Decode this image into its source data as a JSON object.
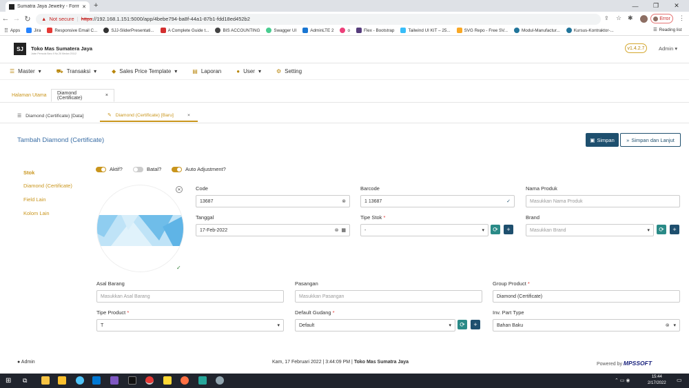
{
  "browser": {
    "tab_title": "Sumatra Jaya Jewelry - Form Di...",
    "not_secure": "Not secure",
    "url_scheme": "https",
    "url_rest": "://192.168.1.151:5000/app/4bebe794-ba8f-44a1-87b1-fdd18ed452b2",
    "error_label": "Error",
    "bookmarks": [
      "Apps",
      "Jira",
      "Responsive Email C...",
      "SJJ-SliderPresentati...",
      "A Complete Guide t...",
      "BIS ACCOUNTING",
      "Swagger UI",
      "AdminLTE 2",
      "o",
      "Flex - Bootstrap",
      "Tailwind UI KIT – 25...",
      "SVG Repo - Free SV...",
      "Modul-Manufactur...",
      "Kursus-Kontraktor-..."
    ],
    "reading_list": "Reading list"
  },
  "app": {
    "brand": "Toko Mas Sumatera Jaya",
    "brand_sub": "Jalan Pemuda Baru II No.26 Medan 20112",
    "version": "v1.4.2.7",
    "admin_menu": "Admin",
    "menu": [
      "Master",
      "Transaksi",
      "Sales Price Template",
      "Laporan",
      "User",
      "Setting"
    ]
  },
  "page_tabs": {
    "home": "Halaman Utama",
    "current": "Diamond (Certificate)"
  },
  "sub_tabs": {
    "data": "Diamond (Certificate) [Data]",
    "new": "Diamond (Certificate) [Baru]"
  },
  "form": {
    "title": "Tambah Diamond (Certificate)",
    "save": "Simpan",
    "save_continue": "Simpan dan Lanjut",
    "side_nav": [
      "Stok",
      "Diamond (Certificate)",
      "Field Lain",
      "Kolom Lain"
    ],
    "toggles": [
      {
        "label": "Aktif?",
        "on": true
      },
      {
        "label": "Batal?",
        "on": false
      },
      {
        "label": "Auto Adjustment?",
        "on": true
      }
    ],
    "code": {
      "label": "Code",
      "value": "13687"
    },
    "barcode": {
      "label": "Barcode",
      "value": "1 13687"
    },
    "nama_produk": {
      "label": "Nama Produk",
      "placeholder": "Masukkan Nama Produk"
    },
    "tanggal": {
      "label": "Tanggal",
      "value": "17-Feb-2022"
    },
    "tipe_stok": {
      "label": "Tipe Stok",
      "value": "-"
    },
    "brand": {
      "label": "Brand",
      "placeholder": "Masukkan Brand"
    },
    "asal_barang": {
      "label": "Asal Barang",
      "placeholder": "Masukkan Asal Barang"
    },
    "pasangan": {
      "label": "Pasangan",
      "placeholder": "Masukkan Pasangan"
    },
    "group_product": {
      "label": "Group Product",
      "value": "Diamond (Certificate)"
    },
    "tipe_product": {
      "label": "Tipe Product",
      "value": "T"
    },
    "default_gudang": {
      "label": "Default Gudang",
      "value": "Default"
    },
    "inv_part_type": {
      "label": "Inv. Part Type",
      "value": "Bahan Baku"
    }
  },
  "footer": {
    "user": "Admin",
    "datetime": "Kam, 17 Februari 2022 | 3:44:09 PM |",
    "company": "Toko Mas Sumatra Jaya",
    "powered": "Powered by",
    "powered_brand": "MPSSOFT"
  },
  "taskbar": {
    "time": "15:44",
    "date": "2/17/2022"
  },
  "colors": {
    "gold": "#c9951c",
    "navy": "#1e4f6e",
    "teal": "#2a8a87",
    "title_blue": "#3a6ea5"
  }
}
